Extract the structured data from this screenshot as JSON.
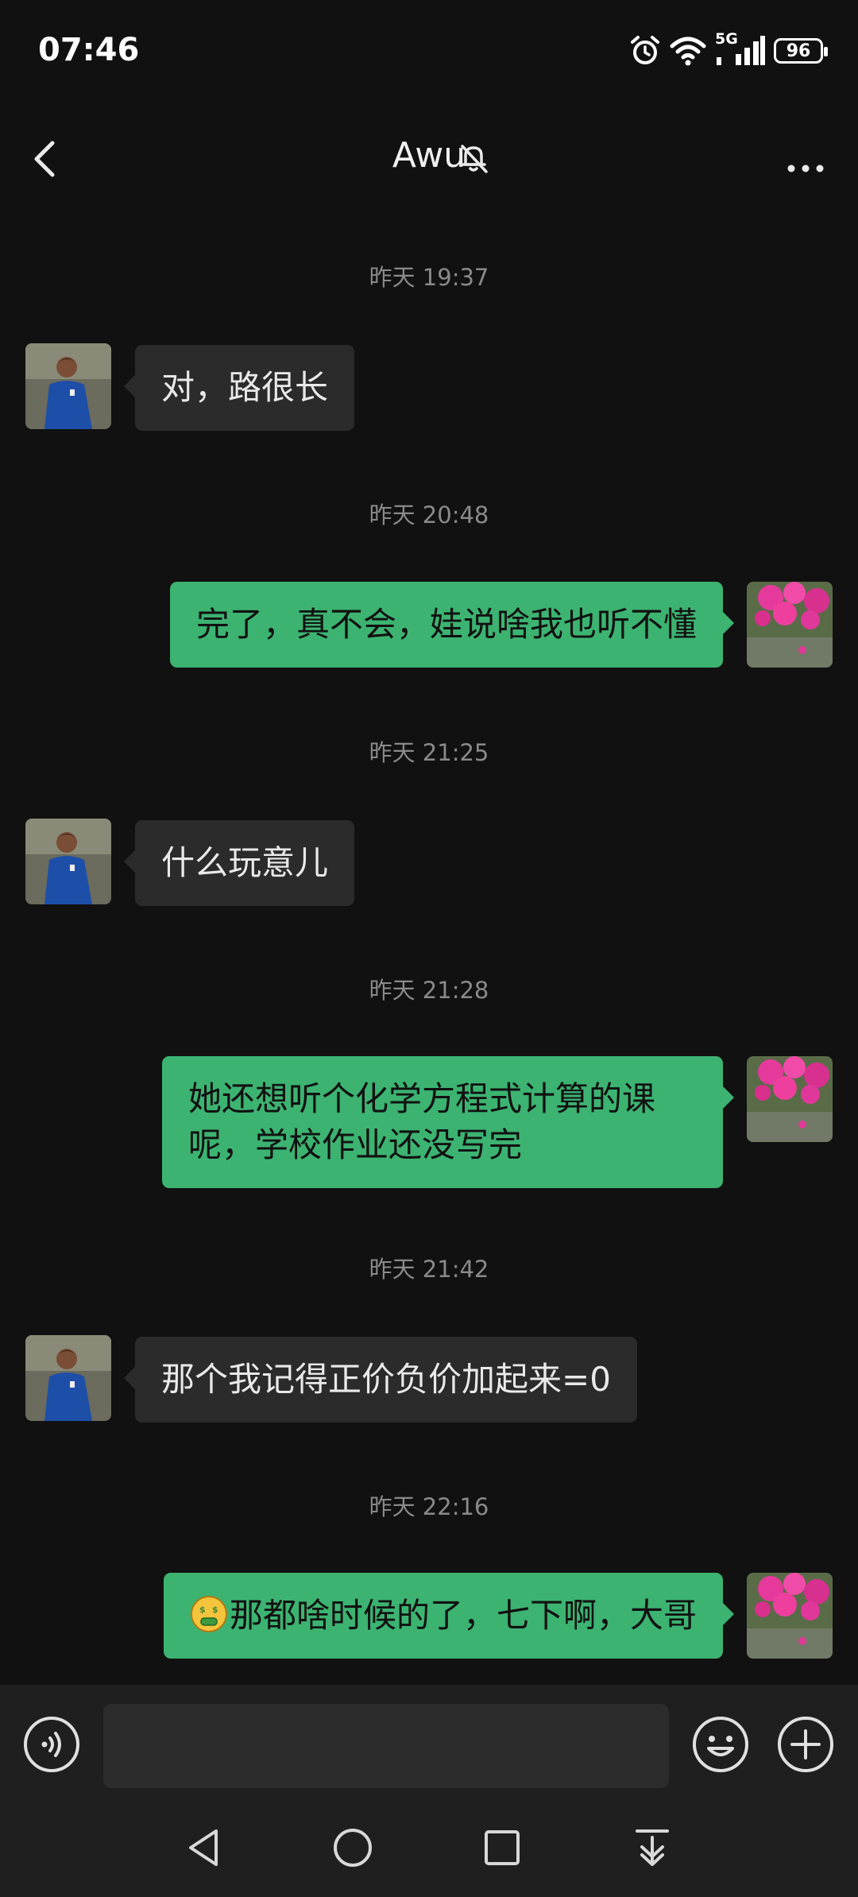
{
  "status": {
    "time": "07:46",
    "network": "5G",
    "battery": "96"
  },
  "header": {
    "title": "Awu",
    "muted": true
  },
  "messages": [
    {
      "timestamp": "昨天 19:37",
      "side": "left",
      "text": "对，路很长"
    },
    {
      "timestamp": "昨天 20:48",
      "side": "right",
      "text": "完了，真不会，娃说啥我也听不懂"
    },
    {
      "timestamp": "昨天 21:25",
      "side": "left",
      "text": "什么玩意儿"
    },
    {
      "timestamp": "昨天 21:28",
      "side": "right",
      "text": "她还想听个化学方程式计算的课呢，学校作业还没写完"
    },
    {
      "timestamp": "昨天 21:42",
      "side": "left",
      "text": "那个我记得正价负价加起来=0"
    },
    {
      "timestamp": "昨天 22:16",
      "side": "right",
      "emoji": "money-mouth-emoji",
      "text": "那都啥时候的了，七下啊，大哥"
    }
  ],
  "input": {
    "value": ""
  },
  "colors": {
    "background": "#111111",
    "sent_bubble": "#3cb371",
    "received_bubble": "#2b2b2b",
    "timestamp": "#8a8a8a",
    "bars": "#1f1f1f"
  },
  "icons": {
    "back": "chevron-left-icon",
    "mute": "bell-off-icon",
    "more": "more-icon",
    "voice": "voice-icon",
    "emoji": "smiley-icon",
    "plus": "plus-icon",
    "nav": [
      "nav-back-icon",
      "nav-home-icon",
      "nav-recents-icon",
      "nav-menu-icon"
    ]
  }
}
